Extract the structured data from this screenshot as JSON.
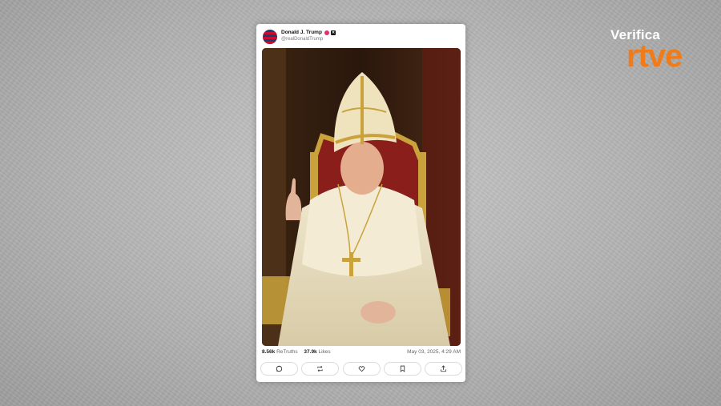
{
  "watermark": {
    "line1": "Verifica",
    "line2": "rtve",
    "accent_color": "#f07c19"
  },
  "post": {
    "author_name": "Donald J. Trump",
    "handle": "@realDonaldTrump",
    "verified_badge_color": "#e0336b",
    "image_description_icon": "photo",
    "retruths_count": "8.56k",
    "retruths_label": "ReTruths",
    "likes_count": "37.9k",
    "likes_label": "Likes",
    "timestamp": "May 03, 2025, 4:29 AM"
  },
  "actions": [
    {
      "name": "reply",
      "icon": "reply-icon"
    },
    {
      "name": "retruth",
      "icon": "retruth-icon"
    },
    {
      "name": "like",
      "icon": "heart-icon"
    },
    {
      "name": "bookmark",
      "icon": "bookmark-icon"
    },
    {
      "name": "share",
      "icon": "share-icon"
    }
  ]
}
